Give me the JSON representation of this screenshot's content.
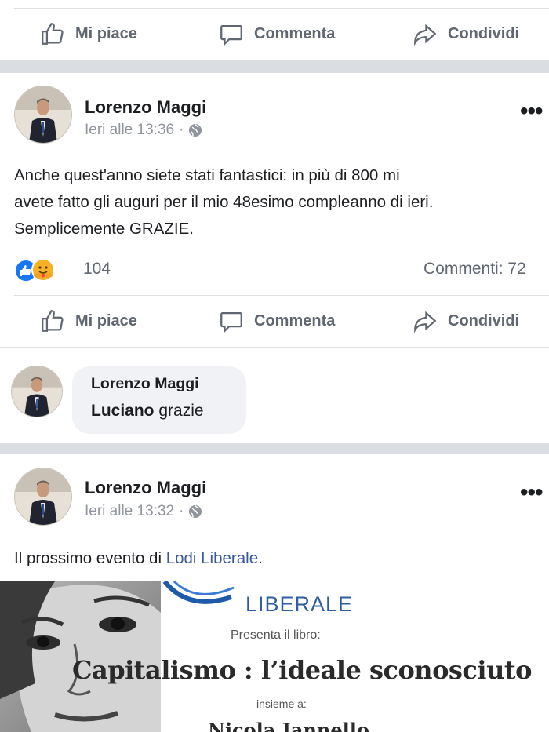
{
  "post1": {
    "actions": {
      "like": "Mi piace",
      "comment": "Commenta",
      "share": "Condividi"
    }
  },
  "post2": {
    "author": "Lorenzo Maggi",
    "time": "Ieri alle 13:36",
    "separator": "·",
    "body_lines": [
      "Anche quest'anno siete stati fantastici: in più di 800 mi",
      "avete fatto gli auguri per il mio 48esimo compleanno di ieri.",
      "Semplicemente GRAZIE."
    ],
    "reaction_count": "104",
    "comments_count": "Commenti: 72",
    "actions": {
      "like": "Mi piace",
      "comment": "Commenta",
      "share": "Condividi"
    },
    "comment": {
      "author": "Lorenzo Maggi",
      "mention": "Luciano",
      "text": "grazie"
    }
  },
  "post3": {
    "author": "Lorenzo Maggi",
    "time": "Ieri alle 13:32",
    "separator": "·",
    "body_prefix": "Il prossimo evento di ",
    "body_link": "Lodi Liberale",
    "body_suffix": ".",
    "image": {
      "org_name": "LIBERALE",
      "presents": "Presenta il libro:",
      "book_title": "Capitalismo : l’ideale sconosciuto",
      "together": "insieme a:",
      "guest": "Nicola Iannello"
    }
  },
  "colors": {
    "link": "#385898",
    "muted": "#606770",
    "separator": "#dadde1",
    "like_blue": "#1877f2",
    "care_yellow": "#f7b125"
  }
}
